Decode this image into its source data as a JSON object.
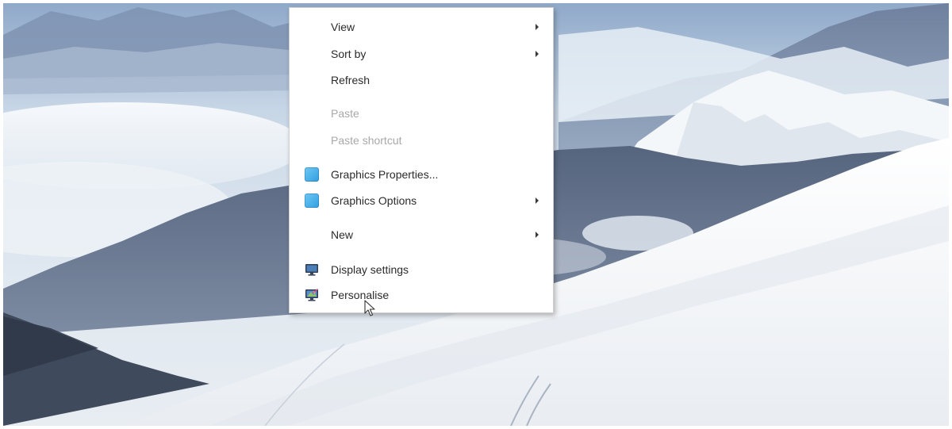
{
  "desktop": {
    "wallpaper_icon": "snowy-mountain-landscape"
  },
  "context_menu": {
    "items": [
      {
        "label": "View",
        "has_submenu": true,
        "enabled": true
      },
      {
        "label": "Sort by",
        "has_submenu": true,
        "enabled": true
      },
      {
        "label": "Refresh",
        "has_submenu": false,
        "enabled": true
      },
      {
        "label": "Paste",
        "has_submenu": false,
        "enabled": false
      },
      {
        "label": "Paste shortcut",
        "has_submenu": false,
        "enabled": false
      },
      {
        "label": "Graphics Properties...",
        "has_submenu": false,
        "enabled": true,
        "icon": "graphics-icon"
      },
      {
        "label": "Graphics Options",
        "has_submenu": true,
        "enabled": true,
        "icon": "graphics-icon"
      },
      {
        "label": "New",
        "has_submenu": true,
        "enabled": true
      },
      {
        "label": "Display settings",
        "has_submenu": false,
        "enabled": true,
        "icon": "display-icon"
      },
      {
        "label": "Personalise",
        "has_submenu": false,
        "enabled": true,
        "icon": "personalise-icon"
      }
    ]
  },
  "colors": {
    "menu_background": "#ffffff",
    "menu_text": "#2b2b2b",
    "menu_text_disabled": "#a8a8a8",
    "graphics_icon": "#3aa6e6"
  }
}
